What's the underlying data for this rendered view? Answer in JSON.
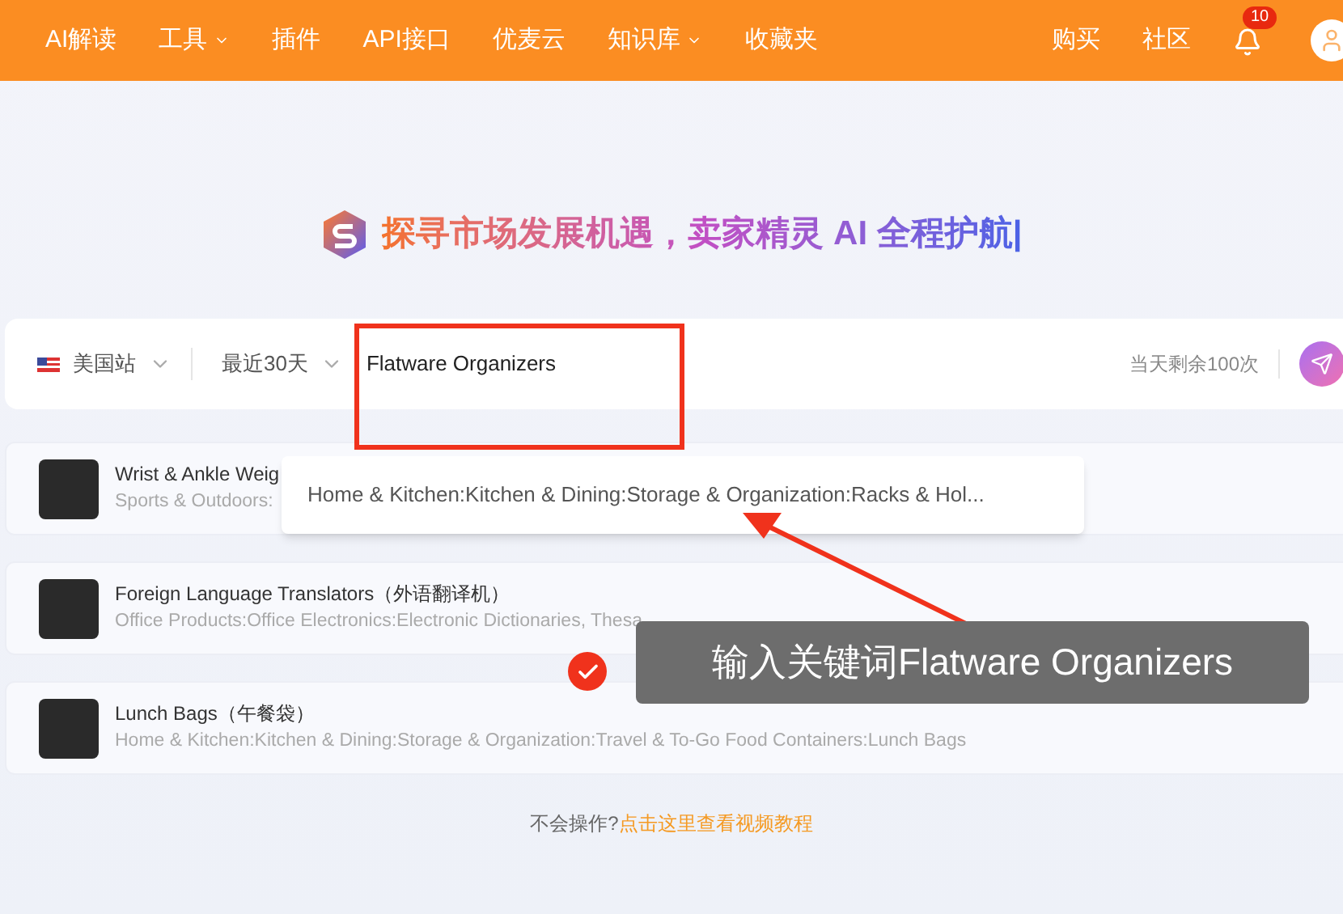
{
  "nav": {
    "items": [
      {
        "label": "AI解读",
        "dropdown": false
      },
      {
        "label": "工具",
        "dropdown": true
      },
      {
        "label": "插件",
        "dropdown": false
      },
      {
        "label": "API接口",
        "dropdown": false
      },
      {
        "label": "优麦云",
        "dropdown": false
      },
      {
        "label": "知识库",
        "dropdown": true
      },
      {
        "label": "收藏夹",
        "dropdown": false
      }
    ],
    "right_links": [
      "购买",
      "社区"
    ],
    "notification_count": "10"
  },
  "headline": "探寻市场发展机遇，卖家精灵 AI 全程护航|",
  "search": {
    "marketplace": "美国站",
    "period": "最近30天",
    "value": "Flatware Organizers",
    "remaining": "当天剩余100次"
  },
  "suggestions": [
    "Home & Kitchen:Kitchen & Dining:Storage & Organization:Racks & Hol..."
  ],
  "results": [
    {
      "title": "Wrist & Ankle Weig",
      "category": "Sports & Outdoors:"
    },
    {
      "title": "Foreign Language Translators（外语翻译机）",
      "category": "Office Products:Office Electronics:Electronic Dictionaries, Thesa"
    },
    {
      "title": "Lunch Bags（午餐袋）",
      "category": "Home & Kitchen:Kitchen & Dining:Storage & Organization:Travel & To-Go Food Containers:Lunch Bags"
    }
  ],
  "help": {
    "prompt": "不会操作?",
    "link": "点击这里查看视频教程"
  },
  "annotation": {
    "caption": "输入关键词Flatware Organizers"
  }
}
